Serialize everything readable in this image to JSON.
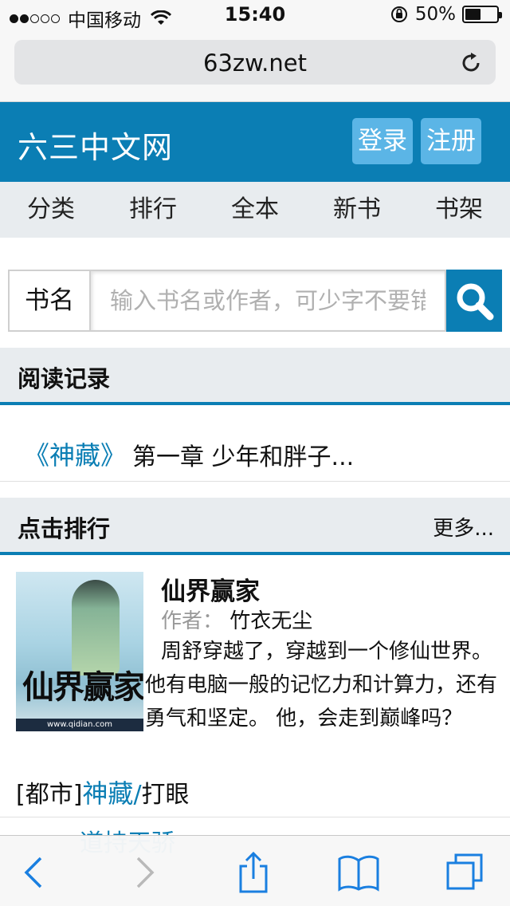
{
  "status_bar": {
    "carrier": "中国移动",
    "time": "15:40",
    "battery": "50%",
    "battery_level": 0.5,
    "signal_bars_filled": 2,
    "signal_bars_total": 5
  },
  "browser": {
    "url": "63zw.net",
    "icons": [
      "reload-icon"
    ]
  },
  "site": {
    "name": "六三中文网",
    "login_label": "登录",
    "register_label": "注册",
    "brand_color": "#0b7eb4"
  },
  "nav": {
    "items": [
      {
        "label": "分类"
      },
      {
        "label": "排行"
      },
      {
        "label": "全本"
      },
      {
        "label": "新书"
      },
      {
        "label": "书架"
      }
    ]
  },
  "search": {
    "field_label": "书名",
    "placeholder": "输入书名或作者，可少字不要错字",
    "icon": "search-icon"
  },
  "reading_history": {
    "title": "阅读记录",
    "book": "《神藏》",
    "chapter": "第一章 少年和胖子..."
  },
  "ranking": {
    "title": "点击排行",
    "more": "更多...",
    "featured": {
      "cover_title": "仙界赢家",
      "title": "仙界赢家",
      "author_label": "作者：",
      "author": "竹衣无尘",
      "description": "周舒穿越了，穿越到一个修仙世界。 他有电脑一般的记忆力和计算力，还有勇气和坚定。 他，会走到巅峰吗？",
      "cover_footer": "www.qidian.com"
    },
    "list": [
      {
        "category": "[都市]",
        "book": "神藏",
        "sep": "/",
        "author": "打眼"
      }
    ],
    "partial_next": "道持天骄"
  },
  "toolbar": {
    "icons": [
      "back-icon",
      "forward-icon",
      "share-icon",
      "bookmarks-icon",
      "tabs-icon"
    ]
  }
}
